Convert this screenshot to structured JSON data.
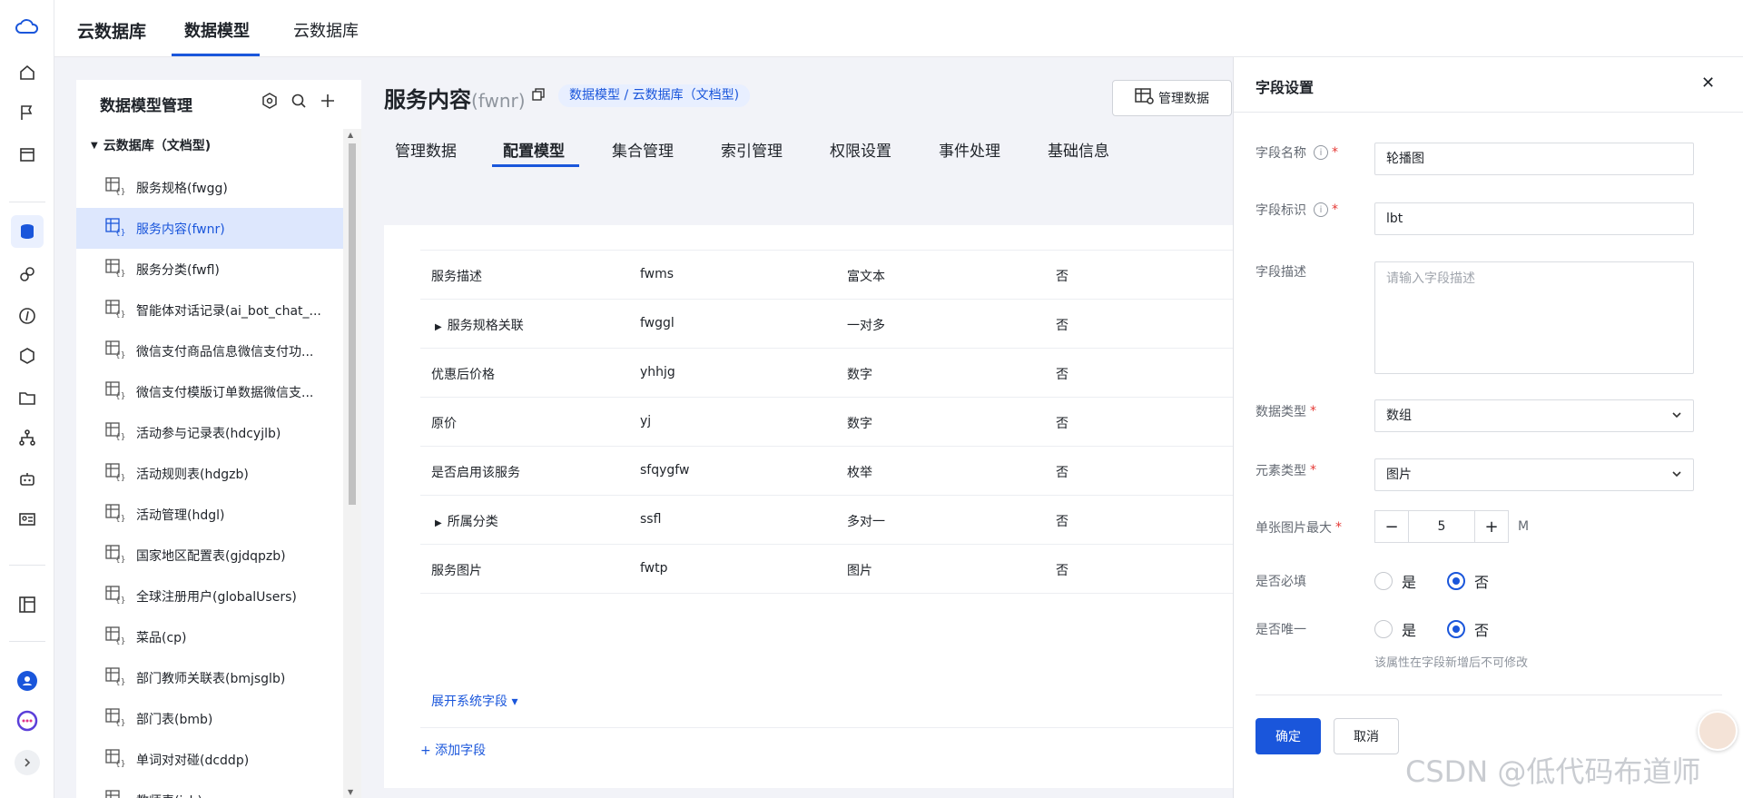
{
  "topbar": {
    "brand": "云数据库",
    "tabs": [
      "数据模型",
      "云数据库"
    ]
  },
  "panel": {
    "title": "数据模型管理",
    "root": "云数据库（文档型)",
    "items": [
      "服务规格(fwgg)",
      "服务内容(fwnr)",
      "服务分类(fwfl)",
      "智能体对话记录(ai_bot_chat_...",
      "微信支付商品信息微信支付功...",
      "微信支付模版订单数据微信支...",
      "活动参与记录表(hdcyjlb)",
      "活动规则表(hdgzb)",
      "活动管理(hdgl)",
      "国家地区配置表(gjdqpzb)",
      "全球注册用户(globalUsers)",
      "菜品(cp)",
      "部门教师关联表(bmjsglb)",
      "部门表(bmb)",
      "单词对对碰(dcddp)",
      "教师表(jsb)"
    ]
  },
  "main": {
    "title": "服务内容",
    "code": "(fwnr)",
    "crumb": "数据模型 / 云数据库（文档型)",
    "manage_btn": "管理数据",
    "tabs": [
      "管理数据",
      "配置模型",
      "集合管理",
      "索引管理",
      "权限设置",
      "事件处理",
      "基础信息"
    ],
    "rows": [
      {
        "name": "服务描述",
        "id": "fwms",
        "type": "富文本",
        "req": "否"
      },
      {
        "name": "服务规格关联",
        "id": "fwggl",
        "type": "一对多",
        "req": "否",
        "expandable": true
      },
      {
        "name": "优惠后价格",
        "id": "yhhjg",
        "type": "数字",
        "req": "否"
      },
      {
        "name": "原价",
        "id": "yj",
        "type": "数字",
        "req": "否"
      },
      {
        "name": "是否启用该服务",
        "id": "sfqygfw",
        "type": "枚举",
        "req": "否"
      },
      {
        "name": "所属分类",
        "id": "ssfl",
        "type": "多对一",
        "req": "否",
        "expandable": true
      },
      {
        "name": "服务图片",
        "id": "fwtp",
        "type": "图片",
        "req": "否"
      }
    ],
    "expand_label": "展开系统字段 ▾",
    "add_label": "+ 添加字段"
  },
  "drawer": {
    "title": "字段设置",
    "field_name_label": "字段名称",
    "field_name_value": "轮播图",
    "field_id_label": "字段标识",
    "field_id_value": "lbt",
    "desc_label": "字段描述",
    "desc_placeholder": "请输入字段描述",
    "data_type_label": "数据类型",
    "data_type_value": "数组",
    "elem_type_label": "元素类型",
    "elem_type_value": "图片",
    "max_size_label": "单张图片最大",
    "max_size_value": "5",
    "max_size_unit": "M",
    "required_label": "是否必填",
    "unique_label": "是否唯一",
    "yes": "是",
    "no": "否",
    "hint": "该属性在字段新增后不可修改",
    "ok": "确定",
    "cancel": "取消"
  },
  "watermark": "CSDN @低代码布道师",
  "colors": {
    "accent": "#1a56db",
    "selected_bg": "#dde7fd"
  }
}
